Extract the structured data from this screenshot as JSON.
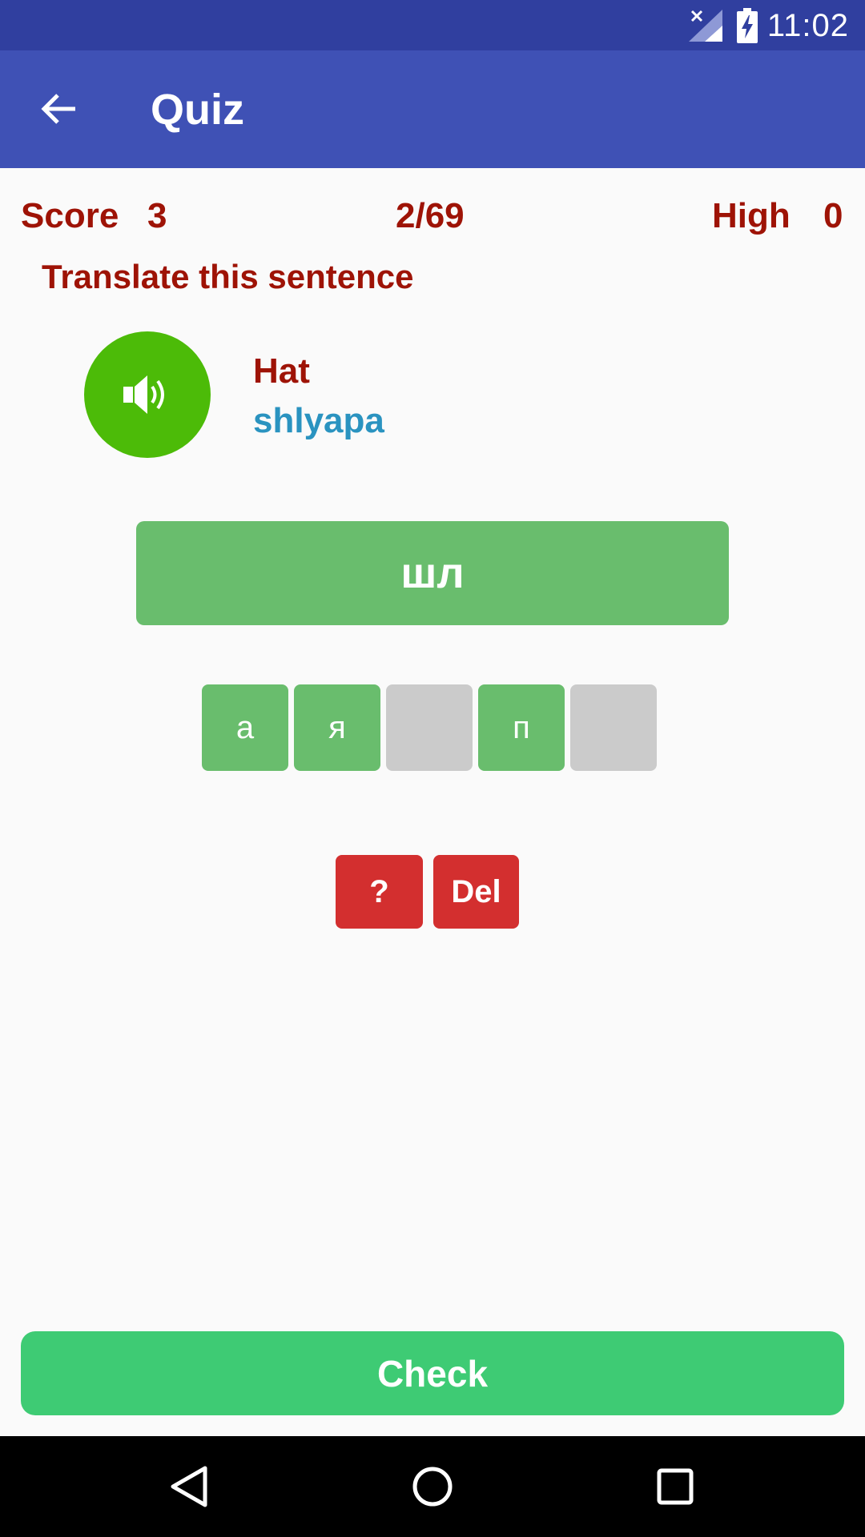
{
  "status_bar": {
    "time": "11:02",
    "icons": [
      "signal-no-data-icon",
      "battery-charging-icon"
    ]
  },
  "app_bar": {
    "title": "Quiz",
    "back_icon": "arrow-back-icon"
  },
  "score": {
    "label": "Score",
    "value": "3",
    "progress": "2/69",
    "high_label": "High",
    "high_value": "0"
  },
  "instruction": "Translate this sentence",
  "word": {
    "english": "Hat",
    "transliteration": "shlyapa",
    "speaker_icon": "speaker-volume-icon"
  },
  "answer": {
    "current": "шл"
  },
  "tiles": [
    {
      "letter": "а",
      "state": "filled"
    },
    {
      "letter": "я",
      "state": "filled"
    },
    {
      "letter": "",
      "state": "empty"
    },
    {
      "letter": "п",
      "state": "filled"
    },
    {
      "letter": "",
      "state": "empty"
    }
  ],
  "actions": {
    "hint_label": "?",
    "delete_label": "Del",
    "check_label": "Check"
  },
  "nav_bar": {
    "icons": [
      "nav-back-icon",
      "nav-home-icon",
      "nav-recents-icon"
    ]
  },
  "colors": {
    "status_bar": "#303f9f",
    "app_bar": "#3f51b5",
    "red_text": "#9e1306",
    "transliteration": "#2a93c0",
    "speaker": "#4cbb08",
    "tile_filled": "#69bd6d",
    "tile_empty": "#cbcbcb",
    "red_button": "#d32f2f",
    "check_button": "#3ecb74"
  }
}
